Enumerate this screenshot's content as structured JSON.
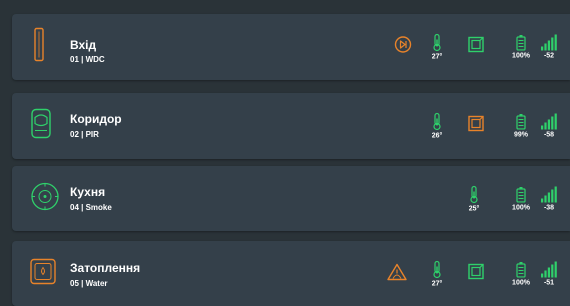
{
  "colors": {
    "background": "#2a3338",
    "card": "#34404a",
    "accent_orange": "#e8832a",
    "accent_green": "#2fd16b",
    "text": "#ffffff"
  },
  "devices": [
    {
      "name": "Вхід",
      "subtitle": "01 | WDC",
      "icon": "door-contact-icon",
      "extra_icon": "dnd-icon",
      "temperature": "27°",
      "tamper": "green",
      "battery": "100%",
      "signal": "-52"
    },
    {
      "name": "Коридор",
      "subtitle": "02 | PIR",
      "icon": "motion-sensor-icon",
      "temperature": "26°",
      "tamper": "orange",
      "battery": "99%",
      "signal": "-58"
    },
    {
      "name": "Кухня",
      "subtitle": "04 | Smoke",
      "icon": "smoke-detector-icon",
      "temperature": "25°",
      "tamper": "green",
      "battery": "100%",
      "signal": "-38"
    },
    {
      "name": "Затоплення",
      "subtitle": "05 | Water",
      "icon": "water-leak-sensor-icon",
      "extra_icon": "alarm-triangle-icon",
      "temperature": "27°",
      "tamper": "green",
      "battery": "100%",
      "signal": "-51"
    }
  ]
}
